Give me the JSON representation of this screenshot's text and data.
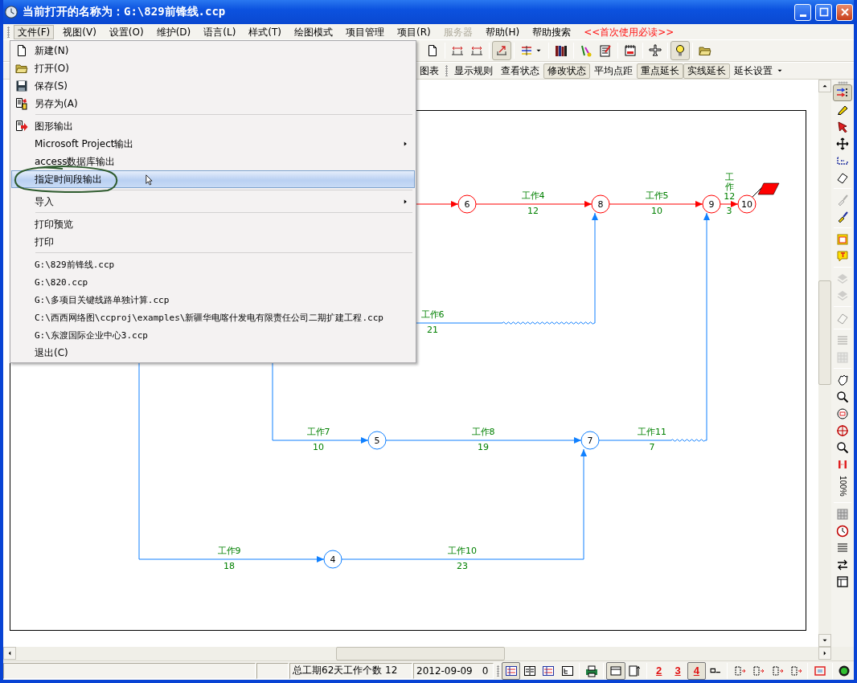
{
  "window": {
    "title": "当前打开的名称为：G:\\829前锋线.ccp"
  },
  "menu_bar": [
    {
      "label": "文件(F)",
      "kind": "menu",
      "selected": true,
      "disabled": false
    },
    {
      "label": "视图(V)",
      "kind": "menu",
      "selected": false,
      "disabled": false
    },
    {
      "label": "设置(O)",
      "kind": "menu",
      "selected": false,
      "disabled": false
    },
    {
      "label": "维护(D)",
      "kind": "menu",
      "selected": false,
      "disabled": false
    },
    {
      "label": "语言(L)",
      "kind": "menu",
      "selected": false,
      "disabled": false
    },
    {
      "label": "样式(T)",
      "kind": "menu",
      "selected": false,
      "disabled": false
    },
    {
      "label": "绘图模式",
      "kind": "menu",
      "selected": false,
      "disabled": false
    },
    {
      "label": "项目管理",
      "kind": "menu",
      "selected": false,
      "disabled": false
    },
    {
      "label": "项目(R)",
      "kind": "menu",
      "selected": false,
      "disabled": false
    },
    {
      "label": "服务器",
      "kind": "menu",
      "selected": false,
      "disabled": true
    },
    {
      "label": "帮助(H)",
      "kind": "menu",
      "selected": false,
      "disabled": false
    },
    {
      "label": "帮助搜索",
      "kind": "menu",
      "selected": false,
      "disabled": false
    },
    {
      "label": "<<首次使用必读>>",
      "kind": "notice",
      "selected": false,
      "disabled": false
    }
  ],
  "toolbar": [
    {
      "kind": "button",
      "pressed": false
    },
    {
      "kind": "separator"
    },
    {
      "kind": "button",
      "pressed": false
    },
    {
      "kind": "button",
      "pressed": false
    },
    {
      "kind": "separator"
    },
    {
      "kind": "button",
      "pressed": true
    },
    {
      "kind": "separator"
    },
    {
      "kind": "dropdown",
      "pressed": false
    },
    {
      "kind": "separator"
    },
    {
      "kind": "button",
      "pressed": false
    },
    {
      "kind": "separator"
    },
    {
      "kind": "button",
      "pressed": false
    },
    {
      "kind": "button",
      "pressed": false
    },
    {
      "kind": "separator"
    },
    {
      "kind": "button",
      "pressed": false
    },
    {
      "kind": "separator"
    },
    {
      "kind": "button",
      "pressed": false
    },
    {
      "kind": "separator"
    },
    {
      "kind": "button",
      "pressed": true
    },
    {
      "kind": "separator"
    },
    {
      "kind": "button",
      "pressed": false
    }
  ],
  "toolbar_2": [
    {
      "kind": "button",
      "label": "图表",
      "pressed": false
    },
    {
      "kind": "grip"
    },
    {
      "kind": "button",
      "label": "显示规则",
      "pressed": false
    },
    {
      "kind": "button",
      "label": "查看状态",
      "pressed": false
    },
    {
      "kind": "button",
      "label": "修改状态",
      "pressed": true
    },
    {
      "kind": "button",
      "label": "平均点距",
      "pressed": false
    },
    {
      "kind": "button",
      "label": "重点延长",
      "pressed": true
    },
    {
      "kind": "button",
      "label": "实线延长",
      "pressed": true
    },
    {
      "kind": "dropdown",
      "label": "延长设置",
      "pressed": false
    }
  ],
  "file_menu": [
    {
      "kind": "item",
      "label": "新建(N)",
      "submenu": false,
      "selected": false,
      "circled": false
    },
    {
      "kind": "item",
      "label": "打开(O)",
      "submenu": false,
      "selected": false,
      "circled": false
    },
    {
      "kind": "item",
      "label": "保存(S)",
      "submenu": false,
      "selected": false,
      "circled": false
    },
    {
      "kind": "item",
      "label": "另存为(A)",
      "submenu": false,
      "selected": false,
      "circled": false
    },
    {
      "kind": "separator"
    },
    {
      "kind": "item",
      "label": "图形输出",
      "submenu": false,
      "selected": false,
      "circled": false
    },
    {
      "kind": "item",
      "label": "Microsoft Project输出",
      "submenu": true,
      "selected": false,
      "circled": false
    },
    {
      "kind": "item",
      "label": "access数据库输出",
      "submenu": false,
      "selected": false,
      "circled": false
    },
    {
      "kind": "item",
      "label": "指定时间段输出",
      "submenu": false,
      "selected": true,
      "circled": true
    },
    {
      "kind": "separator"
    },
    {
      "kind": "item",
      "label": "导入",
      "submenu": true,
      "selected": false,
      "circled": false
    },
    {
      "kind": "separator"
    },
    {
      "kind": "item",
      "label": "打印预览",
      "submenu": false,
      "selected": false,
      "circled": false
    },
    {
      "kind": "item",
      "label": "打印",
      "submenu": false,
      "selected": false,
      "circled": false
    },
    {
      "kind": "separator"
    },
    {
      "kind": "recent",
      "label": "G:\\829前锋线.ccp",
      "submenu": false,
      "selected": false,
      "circled": false
    },
    {
      "kind": "recent",
      "label": "G:\\820.ccp",
      "submenu": false,
      "selected": false,
      "circled": false
    },
    {
      "kind": "recent",
      "label": "G:\\多项目关键线路单独计算.ccp",
      "submenu": false,
      "selected": false,
      "circled": false
    },
    {
      "kind": "recent",
      "label": "C:\\西西网络图\\ccproj\\examples\\新疆华电喀什发电有限责任公司二期扩建工程.ccp",
      "submenu": false,
      "selected": false,
      "circled": false
    },
    {
      "kind": "recent",
      "label": "G:\\东渡国际企业中心3.ccp",
      "submenu": false,
      "selected": false,
      "circled": false
    },
    {
      "kind": "item",
      "label": "退出(C)",
      "submenu": false,
      "selected": false,
      "circled": false
    }
  ],
  "network": {
    "nodes": [
      {
        "label": "6",
        "critical": true,
        "flag": false
      },
      {
        "label": "8",
        "critical": true,
        "flag": false
      },
      {
        "label": "9",
        "critical": true,
        "flag": false
      },
      {
        "label": "10",
        "critical": true,
        "flag": true
      },
      {
        "label": "5",
        "critical": false,
        "flag": false
      },
      {
        "label": "7",
        "critical": false,
        "flag": false
      },
      {
        "label": "4",
        "critical": false,
        "flag": false
      }
    ],
    "activities": [
      {
        "name": "工作4",
        "duration": "12",
        "critical": true,
        "float": false
      },
      {
        "name": "工作5",
        "duration": "10",
        "critical": true,
        "float": false
      },
      {
        "name": "工作12",
        "duration": "3",
        "critical": true,
        "float": false
      },
      {
        "name": "工作6",
        "duration": "21",
        "critical": false,
        "float": true
      },
      {
        "name": "工作7",
        "duration": "10",
        "critical": false,
        "float": false
      },
      {
        "name": "工作8",
        "duration": "19",
        "critical": false,
        "float": false
      },
      {
        "name": "工作11",
        "duration": "7",
        "critical": false,
        "float": true
      },
      {
        "name": "工作9",
        "duration": "18",
        "critical": false,
        "float": false
      },
      {
        "name": "工作10",
        "duration": "23",
        "critical": false,
        "float": false
      }
    ]
  },
  "right_toolbar": [
    {
      "kind": "button",
      "pressed": true,
      "disabled": false
    },
    {
      "kind": "button",
      "pressed": false,
      "disabled": false
    },
    {
      "kind": "button",
      "pressed": false,
      "disabled": false
    },
    {
      "kind": "button",
      "pressed": false,
      "disabled": false
    },
    {
      "kind": "button",
      "pressed": false,
      "disabled": false
    },
    {
      "kind": "button",
      "pressed": false,
      "disabled": false
    },
    {
      "kind": "separator"
    },
    {
      "kind": "button",
      "pressed": false,
      "disabled": true
    },
    {
      "kind": "button",
      "pressed": false,
      "disabled": false
    },
    {
      "kind": "separator"
    },
    {
      "kind": "button",
      "pressed": false,
      "disabled": false
    },
    {
      "kind": "button",
      "pressed": false,
      "disabled": false
    },
    {
      "kind": "separator"
    },
    {
      "kind": "button",
      "pressed": false,
      "disabled": true
    },
    {
      "kind": "button",
      "pressed": false,
      "disabled": true
    },
    {
      "kind": "separator"
    },
    {
      "kind": "button",
      "pressed": false,
      "disabled": true
    },
    {
      "kind": "separator"
    },
    {
      "kind": "button",
      "pressed": false,
      "disabled": true
    },
    {
      "kind": "button",
      "pressed": false,
      "disabled": true
    },
    {
      "kind": "separator"
    },
    {
      "kind": "button",
      "pressed": false,
      "disabled": false
    },
    {
      "kind": "button",
      "pressed": false,
      "disabled": false
    },
    {
      "kind": "button",
      "pressed": false,
      "disabled": false
    },
    {
      "kind": "button",
      "pressed": false,
      "disabled": false
    },
    {
      "kind": "button",
      "pressed": false,
      "disabled": false
    },
    {
      "kind": "button",
      "pressed": false,
      "disabled": false
    },
    {
      "kind": "text",
      "label": "100%",
      "disabled": false
    },
    {
      "kind": "separator"
    },
    {
      "kind": "button",
      "pressed": false,
      "disabled": false
    },
    {
      "kind": "button",
      "pressed": false,
      "disabled": false
    },
    {
      "kind": "button",
      "pressed": false,
      "disabled": false
    },
    {
      "kind": "button",
      "pressed": false,
      "disabled": false
    },
    {
      "kind": "button",
      "pressed": false,
      "disabled": false
    }
  ],
  "status_bar": {
    "summary": "总工期62天工作个数 12",
    "date": "2012-09-09",
    "count": "0",
    "buttons": [
      {
        "kind": "button",
        "pressed": true
      },
      {
        "kind": "button",
        "pressed": false
      },
      {
        "kind": "button",
        "pressed": false
      },
      {
        "kind": "button",
        "pressed": false
      },
      {
        "kind": "separator"
      },
      {
        "kind": "button",
        "pressed": false
      },
      {
        "kind": "separator"
      },
      {
        "kind": "button",
        "pressed": true
      },
      {
        "kind": "button",
        "pressed": false
      },
      {
        "kind": "separator"
      },
      {
        "kind": "digit",
        "label": "2",
        "pressed": false
      },
      {
        "kind": "digit",
        "label": "3",
        "pressed": false
      },
      {
        "kind": "digit",
        "label": "4",
        "pressed": true
      },
      {
        "kind": "button",
        "pressed": false
      },
      {
        "kind": "separator"
      },
      {
        "kind": "button",
        "pressed": false
      },
      {
        "kind": "button",
        "pressed": false
      },
      {
        "kind": "button",
        "pressed": false
      },
      {
        "kind": "button",
        "pressed": false
      },
      {
        "kind": "separator"
      },
      {
        "kind": "button",
        "pressed": false
      },
      {
        "kind": "separator"
      },
      {
        "kind": "button",
        "pressed": false
      }
    ]
  }
}
